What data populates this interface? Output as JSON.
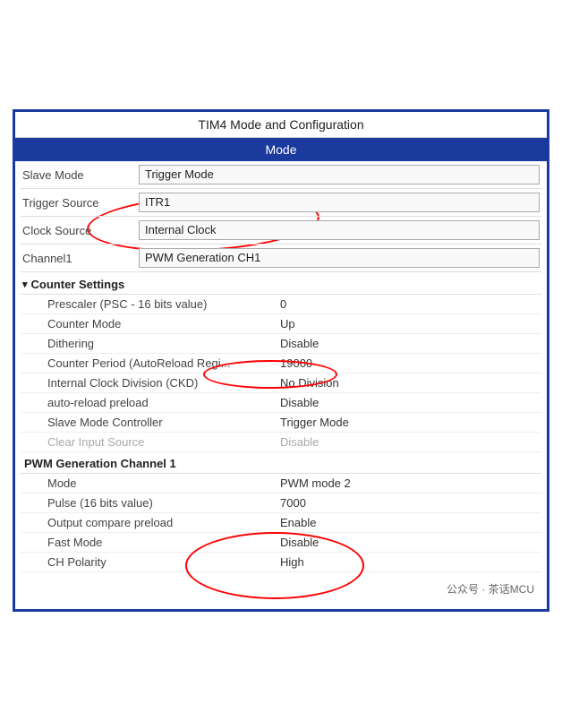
{
  "header": {
    "title": "TIM4 Mode and Configuration",
    "mode_section": "Mode"
  },
  "top_fields": [
    {
      "label": "Slave Mode",
      "value": "Trigger Mode"
    },
    {
      "label": "Trigger Source",
      "value": "ITR1"
    },
    {
      "label": "Clock Source",
      "value": "Internal Clock"
    },
    {
      "label": "Channel1",
      "value": "PWM Generation CH1"
    }
  ],
  "counter_settings": {
    "header": "Counter Settings",
    "rows": [
      {
        "label": "Prescaler (PSC - 16 bits value)",
        "value": "0"
      },
      {
        "label": "Counter Mode",
        "value": "Up"
      },
      {
        "label": "Dithering",
        "value": "Disable"
      },
      {
        "label": "Counter Period (AutoReload Regi...",
        "value": "19000"
      },
      {
        "label": "Internal Clock Division (CKD)",
        "value": "No Division"
      },
      {
        "label": "auto-reload preload",
        "value": "Disable"
      },
      {
        "label": "Slave Mode Controller",
        "value": "Trigger Mode"
      },
      {
        "label": "Clear Input Source",
        "value": "Disable"
      }
    ]
  },
  "pwm_generation": {
    "header": "PWM Generation Channel 1",
    "rows": [
      {
        "label": "Mode",
        "value": "PWM mode 2"
      },
      {
        "label": "Pulse (16 bits value)",
        "value": "7000"
      },
      {
        "label": "Output compare preload",
        "value": "Enable"
      },
      {
        "label": "Fast Mode",
        "value": "Disable"
      },
      {
        "label": "CH Polarity",
        "value": "High"
      }
    ]
  },
  "watermark": "公众号 · 茶话MCU"
}
